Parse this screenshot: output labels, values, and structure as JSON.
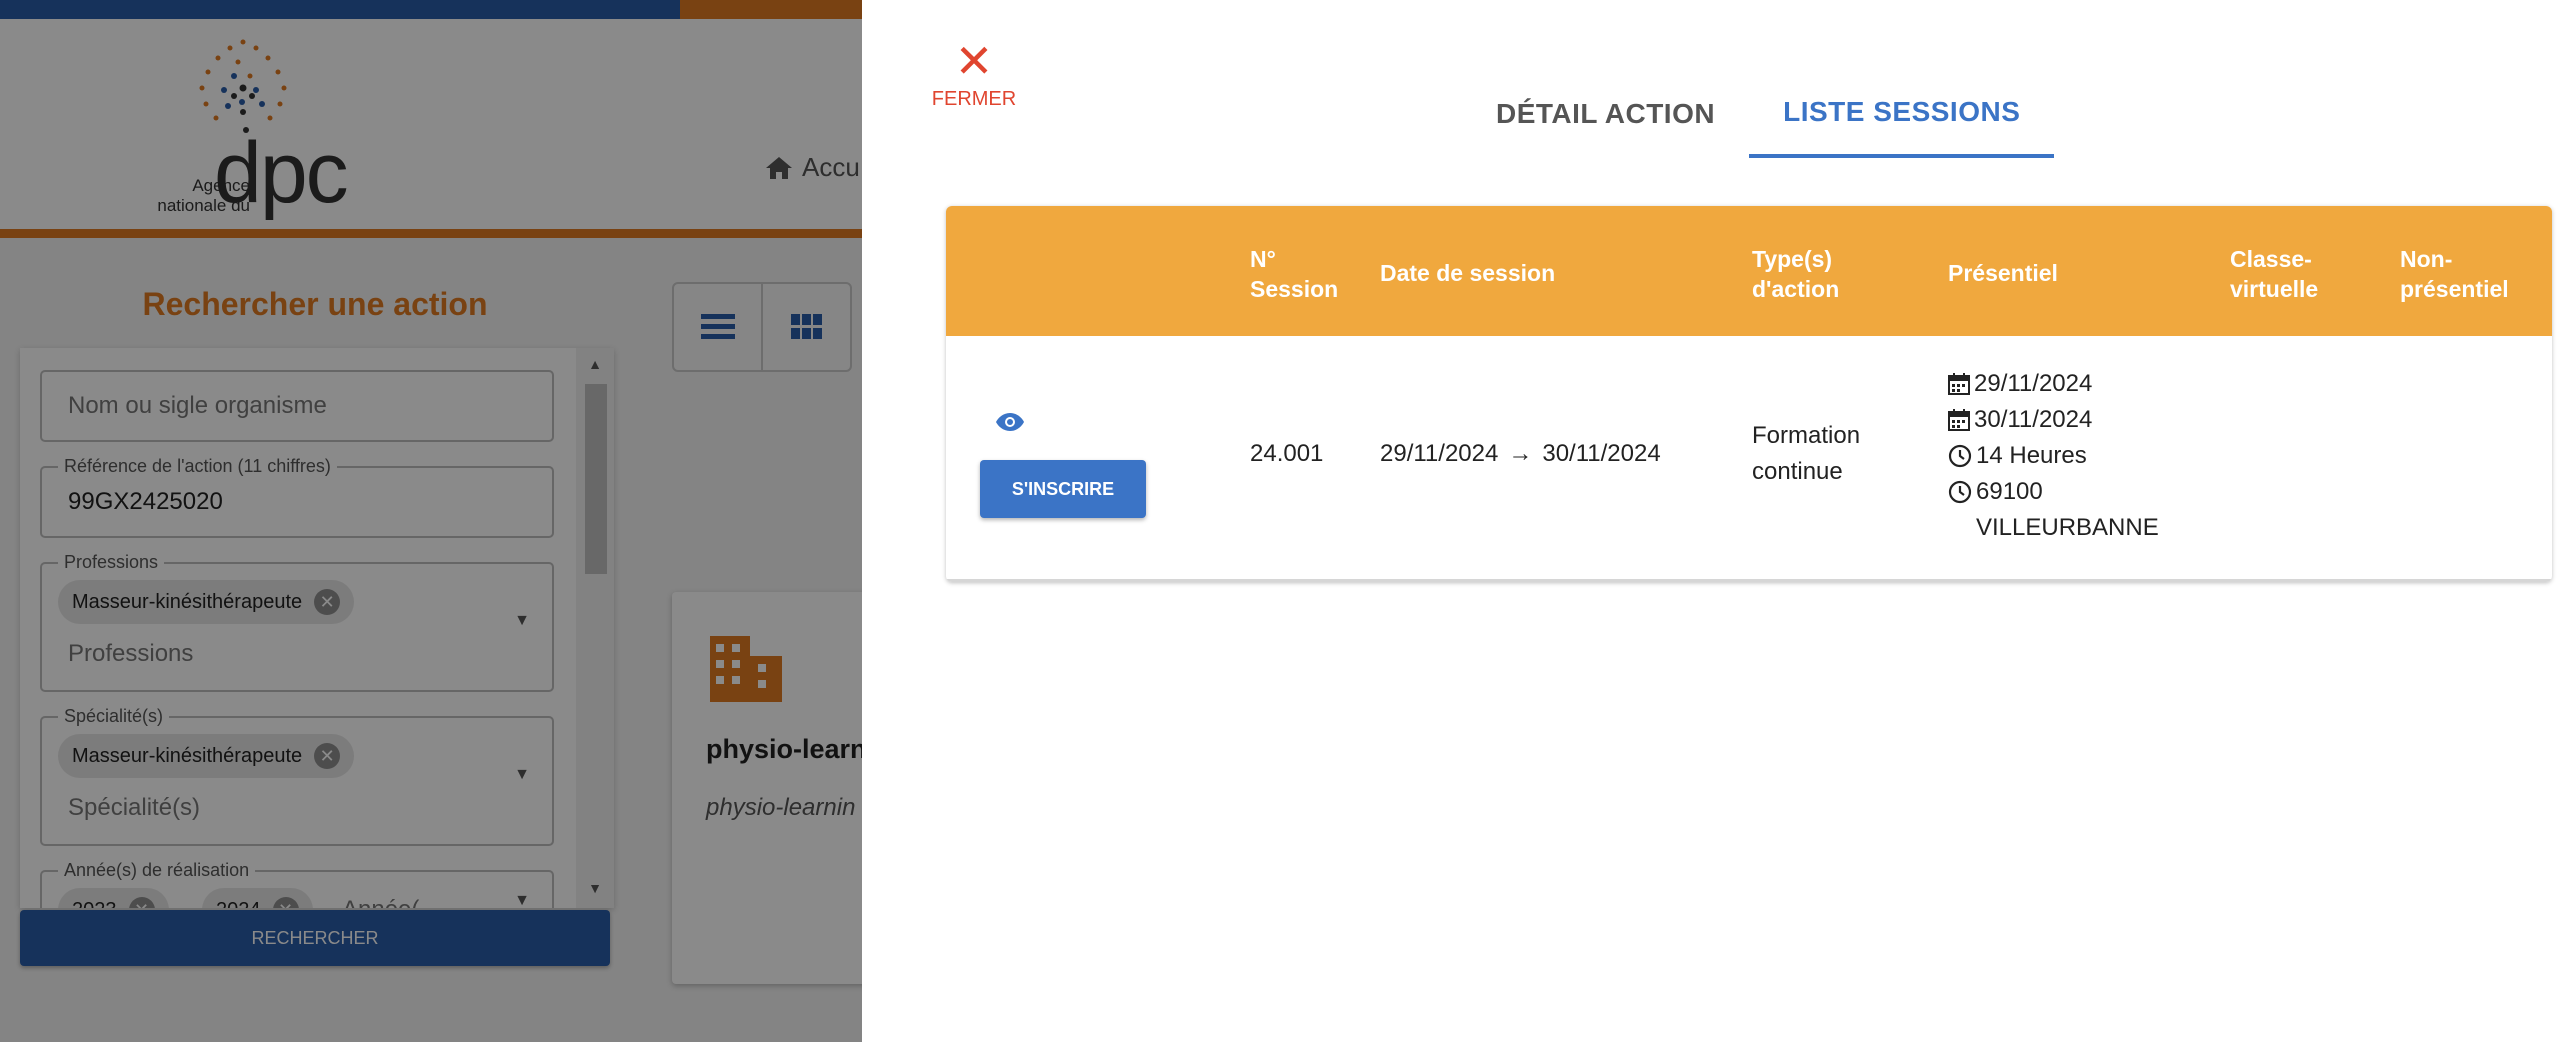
{
  "background": {
    "logo": {
      "agence_text": "Agence nationale du",
      "dpc_text": "dpc"
    },
    "nav": {
      "home_label": "Accu"
    },
    "search_title": "Rechercher une action",
    "filters": {
      "organisme_placeholder": "Nom ou sigle organisme",
      "reference_label": "Référence de l'action (11 chiffres)",
      "reference_value": "99GX2425020",
      "professions_label": "Professions",
      "professions_chip": "Masseur-kinésithérapeute",
      "professions_placeholder": "Professions",
      "specialites_label": "Spécialité(s)",
      "specialites_chip": "Masseur-kinésithérapeute",
      "specialites_placeholder": "Spécialité(s)",
      "annees_label": "Année(s) de réalisation",
      "annees_chips": [
        "2023",
        "2024"
      ],
      "annees_placeholder": "Année("
    },
    "search_button": "RECHERCHER",
    "result_card": {
      "title": "physio-learn",
      "subtitle": "physio-learnin"
    }
  },
  "dialog": {
    "close_label": "FERMER",
    "tabs": [
      {
        "label": "DÉTAIL ACTION",
        "active": false
      },
      {
        "label": "LISTE SESSIONS",
        "active": true
      }
    ],
    "table": {
      "headers": {
        "session_line1": "N°",
        "session_line2": "Session",
        "date": "Date de session",
        "type_line1": "Type(s)",
        "type_line2": "d'action",
        "presentiel": "Présentiel",
        "classe_line1": "Classe-",
        "classe_line2": "virtuelle",
        "non_line1": "Non-",
        "non_line2": "présentiel"
      },
      "rows": [
        {
          "session": "24.001",
          "date_start": "29/11/2024",
          "date_arrow": "→",
          "date_end": "30/11/2024",
          "type_line1": "Formation",
          "type_line2": "continue",
          "presentiel": {
            "date1": "29/11/2024",
            "date2": "30/11/2024",
            "duration": "14 Heures",
            "postcode": "69100",
            "city": "VILLEURBANNE"
          },
          "button": "S'INSCRIRE"
        }
      ]
    }
  },
  "colors": {
    "orange": "#f0a83e",
    "blue": "#3b74c6",
    "red": "#e0452f",
    "brand_orange": "#e07b22",
    "brand_blue": "#2a5da8"
  }
}
